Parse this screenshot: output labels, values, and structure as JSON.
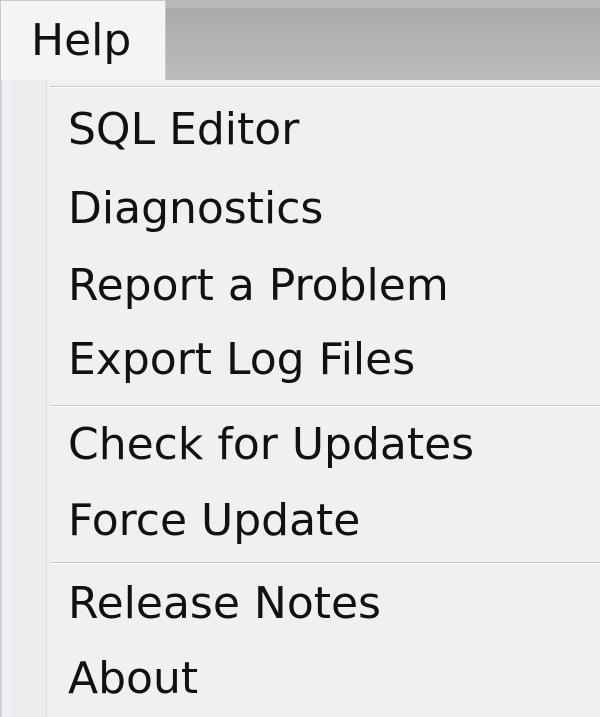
{
  "menubar": {
    "help_label": "Help"
  },
  "help_menu": {
    "group1": [
      {
        "label": "SQL Editor"
      },
      {
        "label": "Diagnostics"
      },
      {
        "label": "Report a Problem"
      },
      {
        "label": "Export Log Files"
      }
    ],
    "group2": [
      {
        "label": "Check for Updates"
      },
      {
        "label": "Force Update"
      }
    ],
    "group3": [
      {
        "label": "Release Notes"
      },
      {
        "label": "About"
      }
    ]
  }
}
